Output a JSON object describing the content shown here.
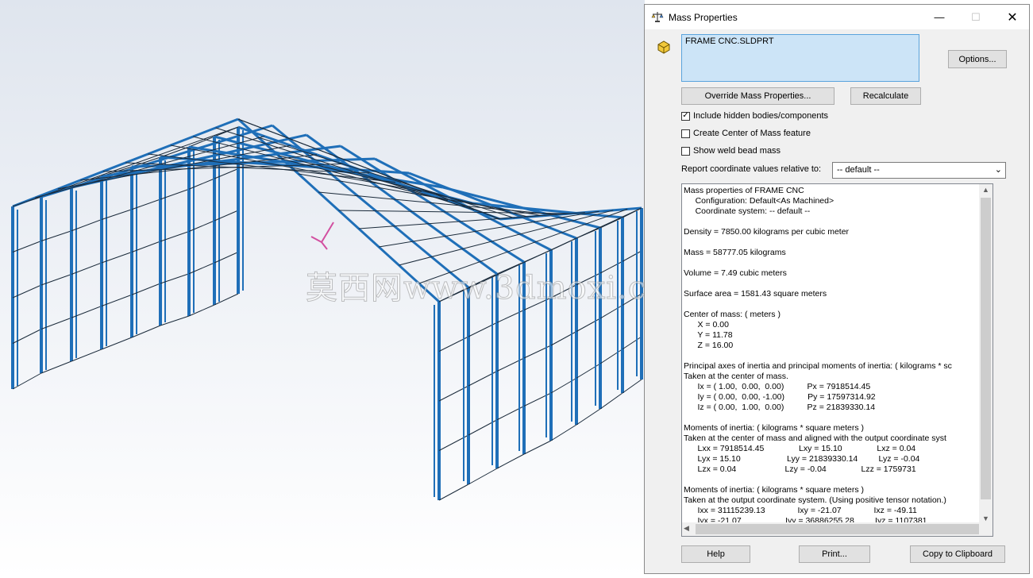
{
  "dialog": {
    "title": "Mass Properties",
    "title_icon": "scale-icon",
    "file_icon": "part-icon",
    "selected_item": "FRAME CNC.SLDPRT",
    "buttons": {
      "options": "Options...",
      "override": "Override Mass Properties...",
      "recalculate": "Recalculate",
      "help": "Help",
      "print": "Print...",
      "clipboard": "Copy to Clipboard"
    },
    "checkboxes": [
      {
        "label": "Include hidden bodies/components",
        "checked": true,
        "mark": "✓"
      },
      {
        "label": "Create Center of Mass feature",
        "checked": false,
        "mark": ""
      },
      {
        "label": "Show weld bead mass",
        "checked": false,
        "mark": ""
      }
    ],
    "report_label": "Report coordinate values relative to:",
    "report_select_value": "-- default --",
    "results_lines": [
      "Mass properties of FRAME CNC",
      "     Configuration: Default<As Machined>",
      "     Coordinate system: -- default --",
      "",
      "Density = 7850.00 kilograms per cubic meter",
      "",
      "Mass = 58777.05 kilograms",
      "",
      "Volume = 7.49 cubic meters",
      "",
      "Surface area = 1581.43 square meters",
      "",
      "Center of mass: ( meters )",
      "      X = 0.00",
      "      Y = 11.78",
      "      Z = 16.00",
      "",
      "Principal axes of inertia and principal moments of inertia: ( kilograms * sc",
      "Taken at the center of mass.",
      "      Ix = ( 1.00,  0.00,  0.00)          Px = 7918514.45",
      "      Iy = ( 0.00,  0.00, -1.00)          Py = 17597314.92",
      "      Iz = ( 0.00,  1.00,  0.00)          Pz = 21839330.14",
      "",
      "Moments of inertia: ( kilograms * square meters )",
      "Taken at the center of mass and aligned with the output coordinate syst",
      "      Lxx = 7918514.45               Lxy = 15.10               Lxz = 0.04",
      "      Lyx = 15.10                    Lyy = 21839330.14         Lyz = -0.04",
      "      Lzx = 0.04                     Lzy = -0.04               Lzz = 1759731",
      "",
      "Moments of inertia: ( kilograms * square meters )",
      "Taken at the output coordinate system. (Using positive tensor notation.)",
      "      Ixx = 31115239.13              Ixy = -21.07              Ixz = -49.11",
      "      Iyx = -21.07                   Iyy = 36886255.28         Iyz = 1107381"
    ]
  },
  "viewport": {
    "watermark": "莫西网www.3dmoxi.com",
    "frame_color": "#1f6fb8",
    "triad_color": "#d24fa0"
  }
}
